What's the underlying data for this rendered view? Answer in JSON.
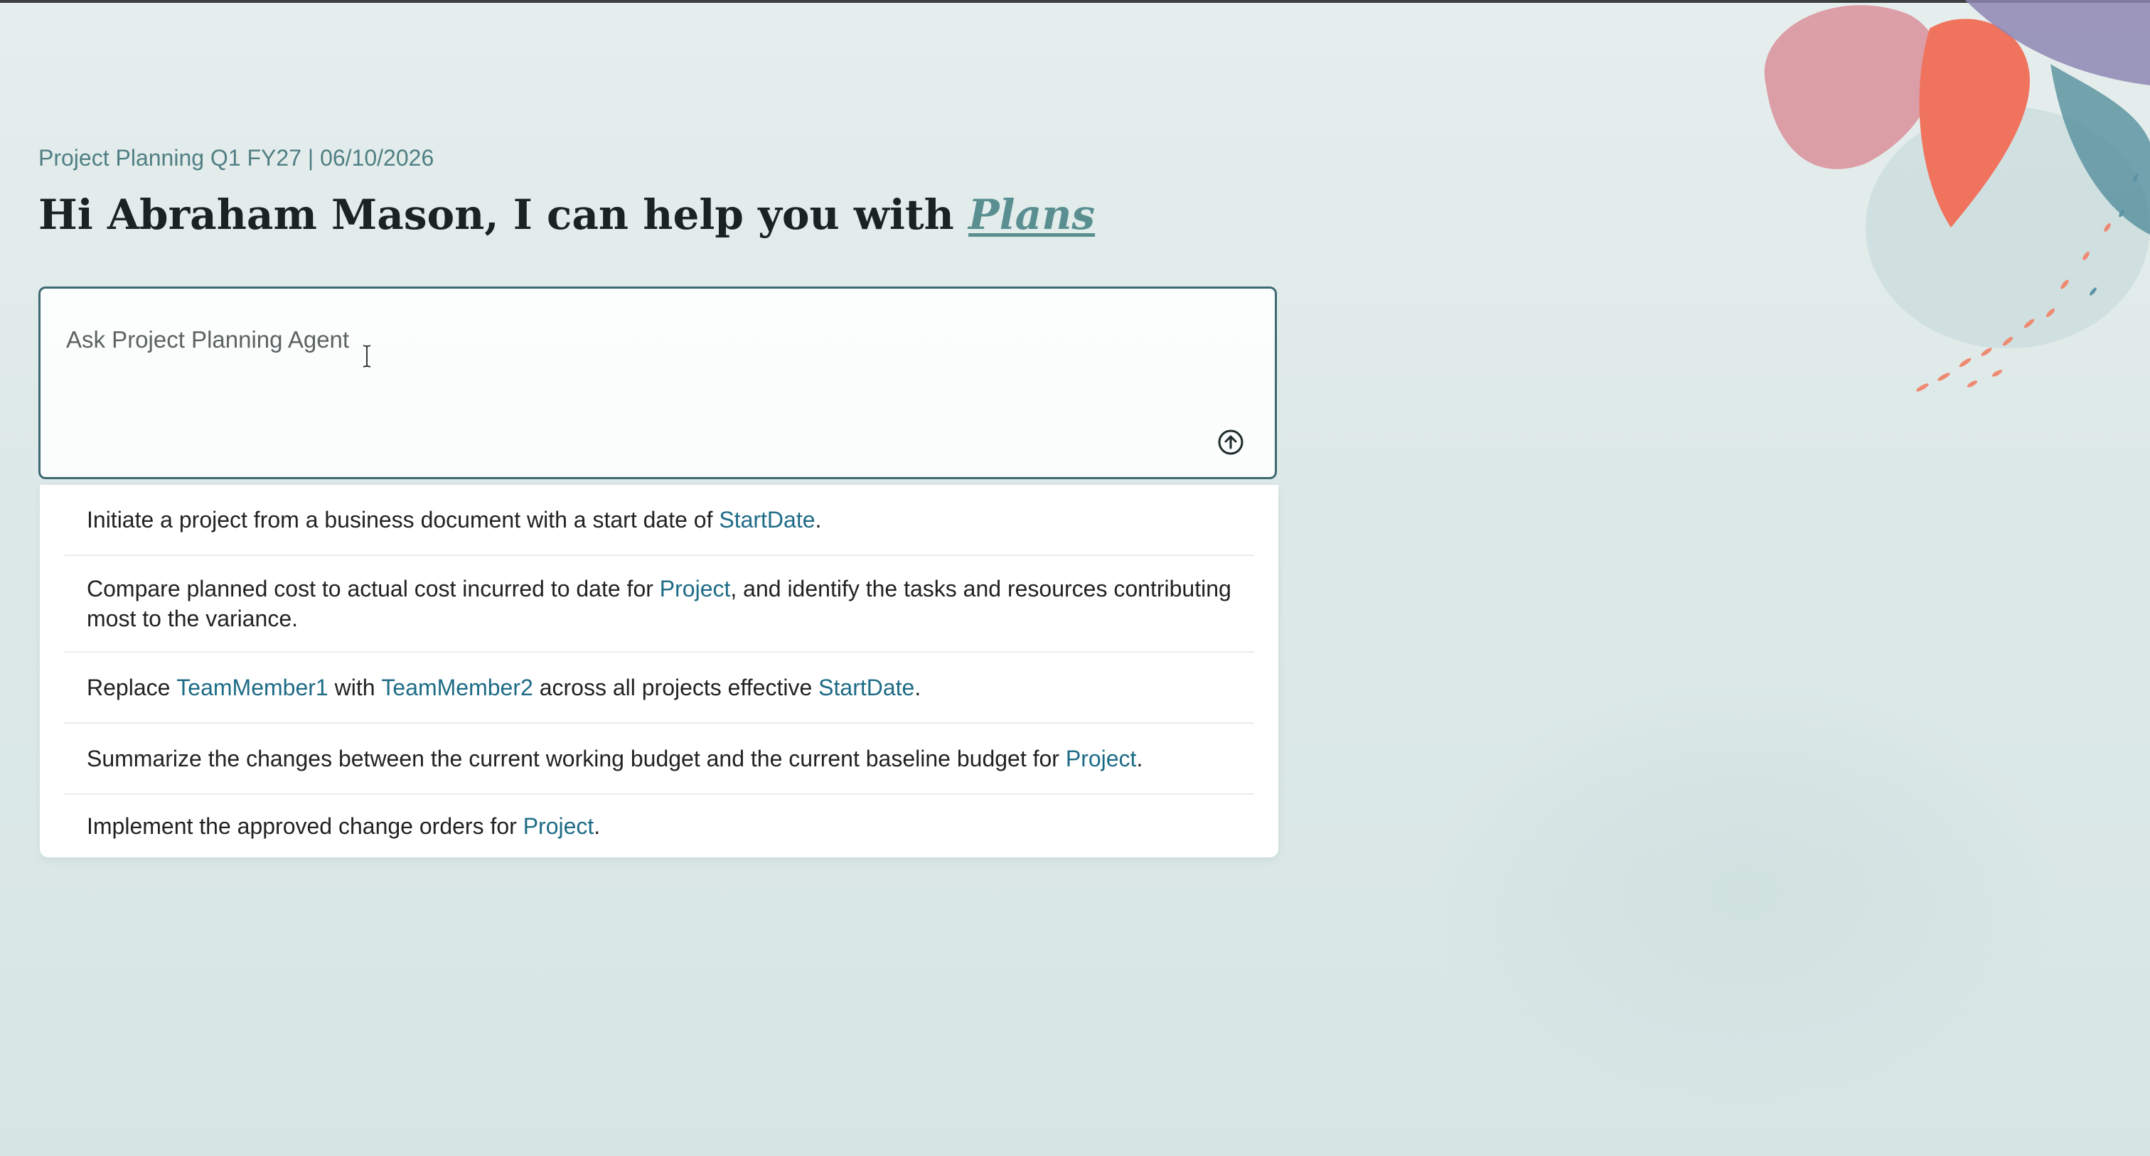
{
  "header": {
    "context": "Project Planning Q1 FY27 | 06/10/2026",
    "greeting_prefix": "Hi Abraham Mason, I can help you with ",
    "greeting_highlight": "Plans"
  },
  "prompt": {
    "placeholder": "Ask Project Planning Agent",
    "value": "",
    "send_icon": "arrow-up-circle-icon"
  },
  "suggestions": [
    {
      "parts": [
        {
          "text": "Initiate a project from a business document with a start date of "
        },
        {
          "text": "StartDate",
          "token": true
        },
        {
          "text": "."
        }
      ]
    },
    {
      "parts": [
        {
          "text": "Compare planned cost to actual cost incurred to date for "
        },
        {
          "text": "Project",
          "token": true
        },
        {
          "text": ", and identify the tasks and resources contributing most to the variance."
        }
      ]
    },
    {
      "parts": [
        {
          "text": "Replace "
        },
        {
          "text": "TeamMember1",
          "token": true
        },
        {
          "text": " with "
        },
        {
          "text": "TeamMember2",
          "token": true
        },
        {
          "text": " across all projects effective "
        },
        {
          "text": "StartDate",
          "token": true
        },
        {
          "text": "."
        }
      ]
    },
    {
      "parts": [
        {
          "text": "Summarize the changes between the current working budget and the current baseline budget for "
        },
        {
          "text": "Project",
          "token": true
        },
        {
          "text": "."
        }
      ]
    },
    {
      "parts": [
        {
          "text": "Implement the approved change orders for "
        },
        {
          "text": "Project",
          "token": true
        },
        {
          "text": "."
        }
      ]
    }
  ],
  "colors": {
    "accent": "#3c6a70",
    "token": "#1d6b86",
    "context_text": "#4f7f83",
    "highlight": "#5a8f92"
  }
}
